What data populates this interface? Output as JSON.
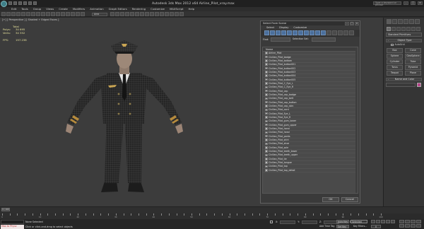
{
  "window": {
    "title": "Autodesk 3ds Max 2012 x64     Airline_Pilot_vray.max",
    "search_placeholder": "Type a keyword or phrase",
    "minimize": "–",
    "maximize": "□",
    "close": "×"
  },
  "menu": [
    "Edit",
    "Tools",
    "Group",
    "Views",
    "Create",
    "Modifiers",
    "Animation",
    "Graph Editors",
    "Rendering",
    "Customize",
    "MAXScript",
    "Help"
  ],
  "toolbar": {
    "filter_value": "Area"
  },
  "viewport": {
    "label": "[+] [ Perspective ] [ Shaded + Edged Faces ]",
    "stats": {
      "total_label": "Total",
      "polys_label": "Polys:",
      "polys_value": "34 695",
      "verts_label": "Verts:",
      "verts_value": "34 352",
      "fps_label": "FPS:",
      "fps_value": "197.238"
    }
  },
  "scene_dialog": {
    "title": "Select From Scene",
    "menu": [
      "Select",
      "Display",
      "Customize"
    ],
    "find_label": "Find:",
    "selection_set_label": "Selection Set:",
    "column_header": "Name",
    "items": [
      "Airline_Pilot",
      "Civilian_Pilot_badge",
      "Civilian_Pilot_bottom",
      "Civilian_Pilot_button001",
      "Civilian_Pilot_button002",
      "Civilian_Pilot_button003",
      "Civilian_Pilot_button004",
      "Civilian_Pilot_button005",
      "Civilian_Pilot_C_Eye_L",
      "Civilian_Pilot_C_Eye_R",
      "Civilian_Pilot_cap",
      "Civilian_Pilot_cap_badge",
      "Civilian_Pilot_cap_belt",
      "Civilian_Pilot_cap_button",
      "Civilian_Pilot_cap_skin",
      "Civilian_Pilot_cord",
      "Civilian_Pilot_Eye_L",
      "Civilian_Pilot_Eye_R",
      "Civilian_Pilot_gum_lower",
      "Civilian_Pilot_gum_upper",
      "Civilian_Pilot_hand",
      "Civilian_Pilot_head",
      "Civilian_Pilot_pants",
      "Civilian_Pilot_shirt",
      "Civilian_Pilot_shoe",
      "Civilian_Pilot_sole",
      "Civilian_Pilot_teeth_lower",
      "Civilian_Pilot_teeth_upper",
      "Civilian_Pilot_tie",
      "Civilian_Pilot_tongue",
      "Civilian_Pilot_top",
      "Civilian_Pilot_top_detail"
    ],
    "ok_label": "OK",
    "cancel_label": "Cancel"
  },
  "command_panel": {
    "dropdown": "Standard Primitives",
    "object_type_header": "Object Type",
    "autogrid_label": "AutoGrid",
    "primitives": [
      "Box",
      "Cone",
      "Sphere",
      "GeoSphere",
      "Cylinder",
      "Tube",
      "Torus",
      "Pyramid",
      "Teapot",
      "Plane"
    ],
    "name_color_header": "Name and Color",
    "name_color_swatch": "#b8448a"
  },
  "timeline": {
    "slider_label": "0 / 100",
    "ticks": [
      "0",
      "10",
      "20",
      "30",
      "40",
      "50",
      "60",
      "70",
      "80",
      "90",
      "100"
    ]
  },
  "status": {
    "maxscript_label": "Max to Physc",
    "selection": "None Selected",
    "prompt": "Click or click-and-drag to select objects",
    "x_label": "X:",
    "y_label": "Y:",
    "z_label": "Z:",
    "grid": "Grid = 10,0cm",
    "add_time_tag": "Add Time Tag",
    "auto_key": "Auto Key",
    "set_key": "Set Key",
    "selected_dropdown": "Selected",
    "key_filters": "Key Filters...",
    "frame": "0"
  }
}
